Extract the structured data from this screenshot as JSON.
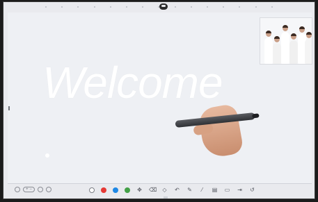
{
  "canvas": {
    "welcome_text": "Welcome"
  },
  "video": {
    "label": "",
    "people_count": 6
  },
  "toolbar": {
    "zoom_label": "+ −",
    "colors": {
      "white": "#ffffff",
      "red": "#e53935",
      "blue": "#1e88e5",
      "green": "#43a047"
    },
    "icons": [
      "circle-icon",
      "red-swatch-icon",
      "blue-swatch-icon",
      "green-swatch-icon",
      "pointer-icon",
      "eraser-icon",
      "shape-icon",
      "undo-icon",
      "pen-icon",
      "pencil-icon",
      "text-icon",
      "folder-icon",
      "export-icon",
      "undo-back-icon"
    ]
  }
}
